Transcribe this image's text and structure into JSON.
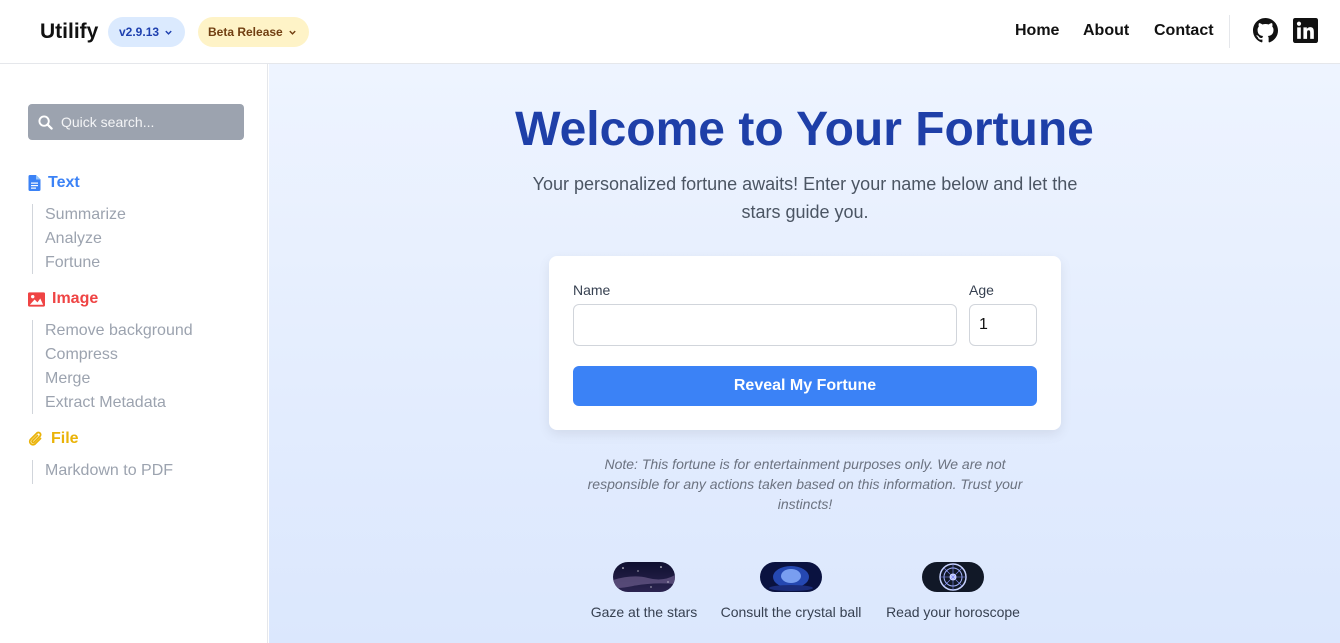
{
  "header": {
    "brand": "Utilify",
    "version": "v2.9.13",
    "beta": "Beta Release",
    "nav": [
      "Home",
      "About",
      "Contact"
    ],
    "social": [
      "github-icon",
      "linkedin-icon"
    ]
  },
  "sidebar": {
    "search_placeholder": "Quick search...",
    "categories": [
      {
        "label": "Text",
        "icon": "file-text-icon",
        "color": "#3b82f6",
        "items": [
          "Summarize",
          "Analyze",
          "Fortune"
        ]
      },
      {
        "label": "Image",
        "icon": "image-icon",
        "color": "#ef4444",
        "items": [
          "Remove background",
          "Compress",
          "Merge",
          "Extract Metadata"
        ]
      },
      {
        "label": "File",
        "icon": "paperclip-icon",
        "color": "#eab308",
        "items": [
          "Markdown to PDF"
        ]
      }
    ]
  },
  "main": {
    "title": "Welcome to Your Fortune",
    "subtitle": "Your personalized fortune awaits! Enter your name below and let the stars guide you.",
    "form": {
      "name_label": "Name",
      "name_value": "",
      "age_label": "Age",
      "age_value": "1",
      "submit_label": "Reveal My Fortune"
    },
    "note": "Note: This fortune is for entertainment purposes only. We are not responsible for any actions taken based on this information. Trust your instincts!",
    "features": [
      {
        "label": "Gaze at the stars",
        "image": "starry-sky-image"
      },
      {
        "label": "Consult the crystal ball",
        "image": "crystal-ball-image"
      },
      {
        "label": "Read your horoscope",
        "image": "zodiac-wheel-image"
      }
    ]
  },
  "colors": {
    "accent": "#3b82f6",
    "title": "#1e3fa8",
    "text_category": "#3b82f6",
    "image_category": "#ef4444",
    "file_category": "#eab308"
  }
}
